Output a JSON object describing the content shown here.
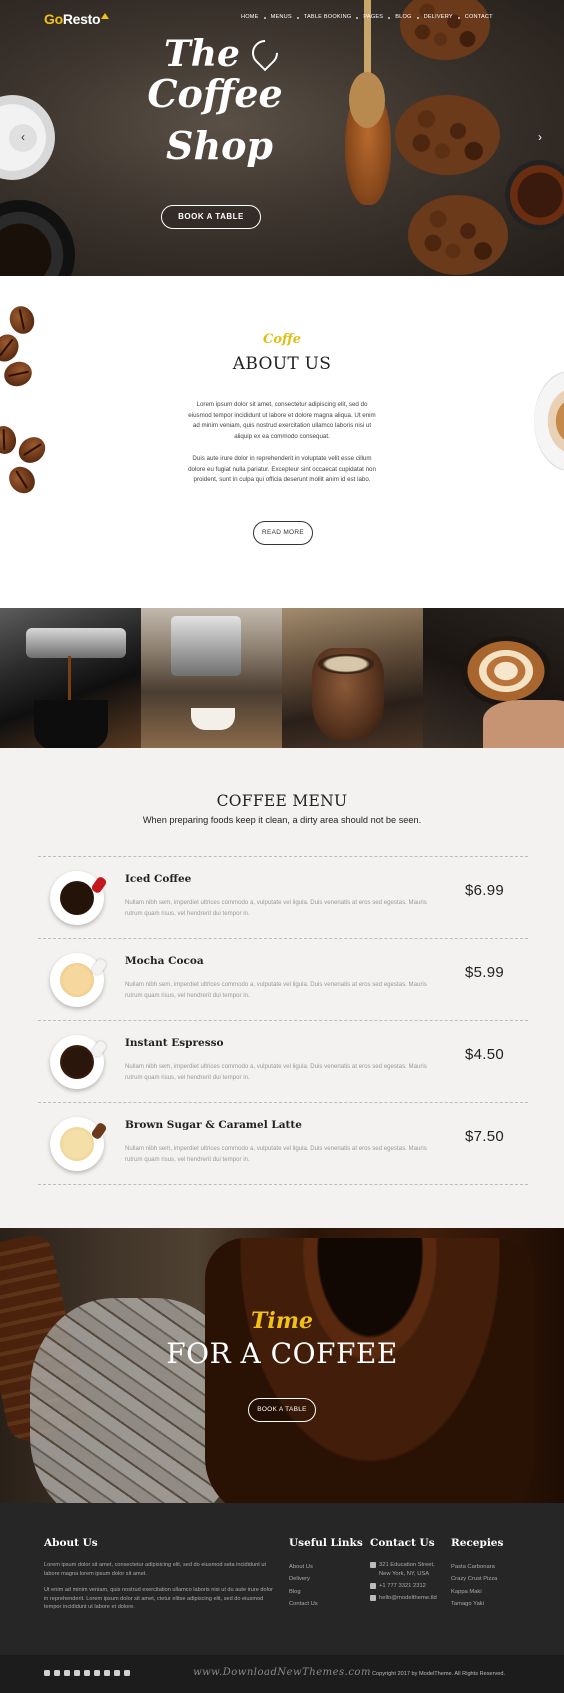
{
  "header": {
    "logo_go": "Go",
    "logo_resto": "Resto",
    "nav": [
      "HOME",
      "MENUS",
      "TABLE BOOKING",
      "PAGES",
      "BLOG",
      "DELIVERY",
      "CONTACT"
    ]
  },
  "hero": {
    "title_line1": "The",
    "title_line2": "Coffee",
    "title_line3": "Shop",
    "button": "BOOK A TABLE",
    "prev_arrow": "‹",
    "next_arrow": "›"
  },
  "about": {
    "script": "Coffe",
    "title": "ABOUT US",
    "paragraph1": "Lorem ipsum dolor sit amet, consectetur adipiscing elit, sed do eiusmod tempor incididunt ut labore et dolore magna aliqua. Ut enim ad minim veniam, quis nostrud exercitation ullamco laboris nisi ut aliquip ex ea commodo consequat.",
    "paragraph2": "Duis aute irure dolor in reprehenderit in voluptate velit esse cillum dolore eu fugiat nulla pariatur. Excepteur sint occaecat cupidatat non proident, sunt in culpa qui officia deserunt mollit anim id est labo.",
    "button": "READ MORE"
  },
  "menu": {
    "title": "COFFEE MENU",
    "subtitle": "When preparing foods keep it clean, a dirty area should not be seen.",
    "items": [
      {
        "name": "Iced Coffee",
        "description": "Nullam nibh sem, imperdiet ultrices commodo a, vulputate vel ligula. Duis venenatis at eros sed egestas. Mauris rutrum quam risus, vel hendrerit dui tempor in.",
        "price": "$6.99"
      },
      {
        "name": "Mocha Cocoa",
        "description": "Nullam nibh sem, imperdiet ultrices commodo a, vulputate vel ligula. Duis venenatis at eros sed egestas. Mauris rutrum quam risus, vel hendrerit dui tempor in.",
        "price": "$5.99"
      },
      {
        "name": "Instant Espresso",
        "description": "Nullam nibh sem, imperdiet ultrices commodo a, vulputate vel ligula. Duis venenatis at eros sed egestas. Mauris rutrum quam risus, vel hendrerit dui tempor in.",
        "price": "$4.50"
      },
      {
        "name": "Brown Sugar & Caramel Latte",
        "description": "Nullam nibh sem, imperdiet ultrices commodo a, vulputate vel ligula. Duis venenatis at eros sed egestas. Mauris rutrum quam risus, vel hendrerit dui tempor in.",
        "price": "$7.50"
      }
    ]
  },
  "cta": {
    "script": "Time",
    "title": "FOR A COFFEE",
    "button": "BOOK A TABLE"
  },
  "footer": {
    "about_title": "About Us",
    "about_p1": "Lorem ipsum dolor sit amet, consectetur adipisicing elit, sed do eiusmod seta incididunt ut labore magna lorem ipsum dolor sit amet.",
    "about_p2": "Ut enim ad minim veniam, quis nostrud exercitation ullamco laboris nisi ut du aute irure dolor in reprehenderit. Lorem ipsum dolor sit amet, ctetur elitse adipiscing elit, sed do eiusmod tempor incididunt ut labore et dolore.",
    "links_title": "Useful Links",
    "links": [
      "About Us",
      "Delivery",
      "Blog",
      "Contact Us"
    ],
    "contact_title": "Contact Us",
    "contact_address": "321 Education Street, New York, NY, USA",
    "contact_phone": "+1 777 3321 2312",
    "contact_email": "hello@modeltheme.tld",
    "recipes_title": "Recepies",
    "recipes": [
      "Pasta Carbonara",
      "Crazy Crust Pizza",
      "Kappa Maki",
      "Tamago Yaki"
    ]
  },
  "bottombar": {
    "watermark": "www.DownloadNewThemes.com",
    "copyright": "Copyright 2017 by ModelTheme. All Rights Reserved."
  },
  "colors": {
    "accent": "#f3c114",
    "footer_bg": "#262626",
    "menu_bg": "#f3f2f0"
  },
  "icons": {
    "social": [
      "facebook-icon",
      "twitter-icon",
      "google-plus-icon",
      "pinterest-icon",
      "linkedin-icon",
      "tumblr-icon",
      "instagram-icon",
      "dribbble-icon",
      "flickr-icon"
    ],
    "contact": [
      "home-icon",
      "phone-icon",
      "envelope-icon"
    ]
  }
}
